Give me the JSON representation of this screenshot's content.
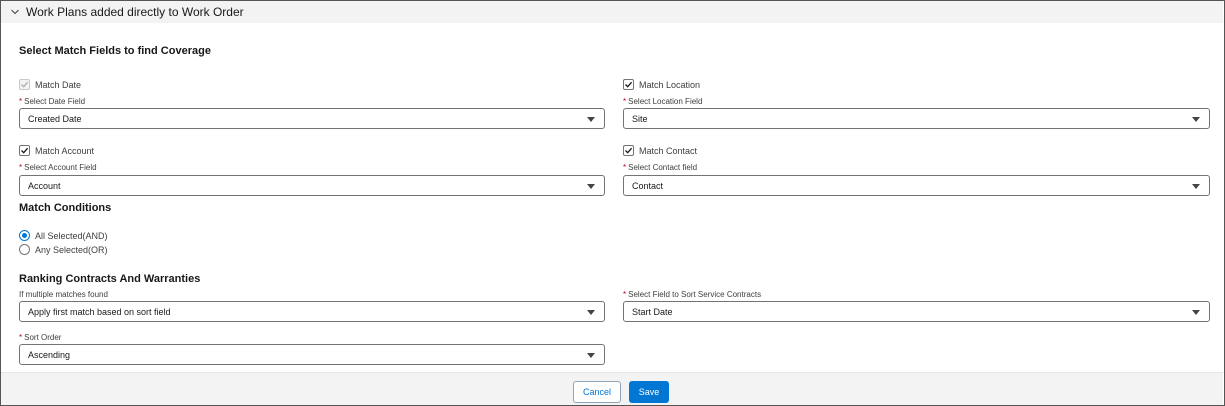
{
  "section": {
    "title": "Work Plans added directly to Work Order"
  },
  "coverage": {
    "heading": "Select Match Fields to find Coverage",
    "match_date": {
      "label": "Match Date",
      "checked": true,
      "disabled": true
    },
    "date_field": {
      "label": "Select Date Field",
      "value": "Created Date"
    },
    "match_location": {
      "label": "Match Location",
      "checked": true
    },
    "location_field": {
      "label": "Select Location Field",
      "value": "Site"
    },
    "match_account": {
      "label": "Match Account",
      "checked": true
    },
    "account_field": {
      "label": "Select Account Field",
      "value": "Account"
    },
    "match_contact": {
      "label": "Match Contact",
      "checked": true
    },
    "contact_field": {
      "label": "Select Contact field",
      "value": "Contact"
    }
  },
  "conditions": {
    "heading": "Match Conditions",
    "options": [
      {
        "label": "All Selected(AND)",
        "selected": true
      },
      {
        "label": "Any Selected(OR)",
        "selected": false
      }
    ]
  },
  "ranking": {
    "heading": "Ranking Contracts And Warranties",
    "multiple_matches": {
      "label": "If multiple matches found",
      "value": "Apply first match based on sort field"
    },
    "sort_field": {
      "label": "Select Field to Sort Service Contracts",
      "value": "Start Date"
    },
    "sort_order": {
      "label": "Sort Order",
      "value": "Ascending"
    }
  },
  "footer": {
    "cancel_label": "Cancel",
    "save_label": "Save"
  },
  "required_marker": "*",
  "colors": {
    "brand": "#0176d3",
    "required": "#ba0517",
    "header_bg": "#f3f3f3"
  }
}
